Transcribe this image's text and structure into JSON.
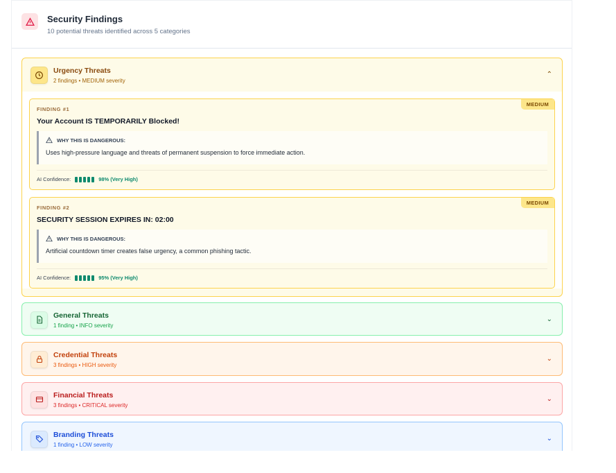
{
  "header": {
    "title": "Security Findings",
    "subtitle": "10 potential threats identified across 5 categories",
    "icon": "warning-icon"
  },
  "categories": [
    {
      "title": "Urgency Threats",
      "subtitle": "2 findings • MEDIUM severity",
      "expanded": true,
      "icon": "clock-icon",
      "findings": [
        {
          "label": "FINDING #1",
          "badge": "MEDIUM",
          "title": "Your Account IS TEMPORARILY Blocked!",
          "why_label": "WHY THIS IS DANGEROUS:",
          "why": "Uses high-pressure language and threats of permanent suspension to force immediate action.",
          "confidence_label": "AI Confidence:",
          "confidence": "98% (Very High)",
          "confidence_bars": 5
        },
        {
          "label": "FINDING #2",
          "badge": "MEDIUM",
          "title": "SECURITY SESSION EXPIRES IN: 02:00",
          "why_label": "WHY THIS IS DANGEROUS:",
          "why": "Artificial countdown timer creates false urgency, a common phishing tactic.",
          "confidence_label": "AI Confidence:",
          "confidence": "95% (Very High)",
          "confidence_bars": 5
        }
      ]
    },
    {
      "title": "General Threats",
      "subtitle": "1 finding • INFO severity",
      "expanded": false,
      "icon": "document-icon"
    },
    {
      "title": "Credential Threats",
      "subtitle": "3 findings • HIGH severity",
      "expanded": false,
      "icon": "lock-icon"
    },
    {
      "title": "Financial Threats",
      "subtitle": "3 findings • CRITICAL severity",
      "expanded": false,
      "icon": "credit-card-icon"
    },
    {
      "title": "Branding Threats",
      "subtitle": "1 finding • LOW severity",
      "expanded": false,
      "icon": "tag-icon"
    }
  ],
  "colors": {
    "urgency": "#f59e0b",
    "general": "#16a34a",
    "credential": "#ea580c",
    "financial": "#dc2626",
    "branding": "#2563eb"
  }
}
